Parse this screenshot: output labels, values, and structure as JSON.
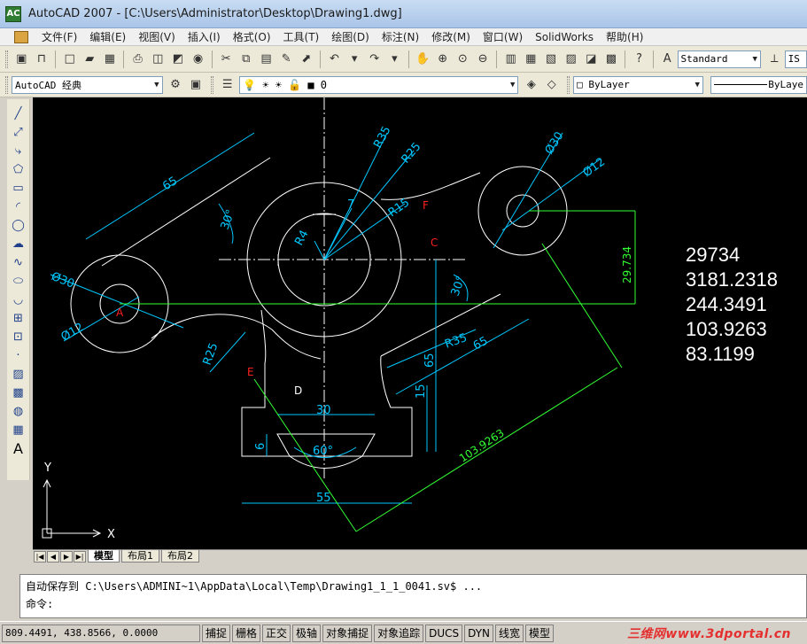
{
  "window": {
    "title": "AutoCAD 2007 - [C:\\Users\\Administrator\\Desktop\\Drawing1.dwg]",
    "app_icon": "AC"
  },
  "menu": [
    "文件(F)",
    "编辑(E)",
    "视图(V)",
    "插入(I)",
    "格式(O)",
    "工具(T)",
    "绘图(D)",
    "标注(N)",
    "修改(M)",
    "窗口(W)",
    "SolidWorks",
    "帮助(H)"
  ],
  "toolbar": {
    "text_style": "Standard",
    "dim_style_partial": "IS",
    "workspace": "AutoCAD 经典",
    "layer": "0",
    "color": "ByLayer",
    "linetype": "ByLaye"
  },
  "drawing": {
    "dims": {
      "d65_top": "65",
      "ang30_left": "30°",
      "r35_top": "R35",
      "r25_top": "R25",
      "r15": "R15",
      "dim7": "7",
      "r4": "R4",
      "phi30_right": "Ø30",
      "phi12_right": "Ø12",
      "phi30_left": "Ø30",
      "phi12_left": "Ø12",
      "r25_left": "R25",
      "ang30_right": "30°",
      "r35_right": "R35",
      "d65_right": "65",
      "d65_vert": "65",
      "d15": "15",
      "d30": "30",
      "d6": "6",
      "ang60": "60°",
      "d55": "55",
      "aligned_29734": "29.734",
      "aligned_103": "103.9263"
    },
    "points": {
      "a": "A",
      "c": "C",
      "d": "D",
      "e": "E",
      "f": "F"
    },
    "results": [
      "29734",
      "3181.2318",
      "244.3491",
      "103.9263",
      "83.1199"
    ],
    "ucs": {
      "x": "X",
      "y": "Y"
    }
  },
  "tabs": {
    "model": "模型",
    "layout1": "布局1",
    "layout2": "布局2"
  },
  "command": {
    "line1": "自动保存到  C:\\Users\\ADMINI~1\\AppData\\Local\\Temp\\Drawing1_1_1_0041.sv$ ...",
    "line2": "命令:"
  },
  "status": {
    "coords": "809.4491, 438.8566, 0.0000",
    "buttons": [
      "捕捉",
      "栅格",
      "正交",
      "极轴",
      "对象捕捉",
      "对象追踪",
      "DUCS",
      "DYN",
      "线宽",
      "模型"
    ],
    "watermark": "三维网www.3dportal.cn"
  },
  "colors": {
    "canvas": "#000000",
    "geometry": "#ffffff",
    "dimension": "#00c8ff",
    "measure": "#33ff33",
    "point_label": "#ff2020"
  }
}
